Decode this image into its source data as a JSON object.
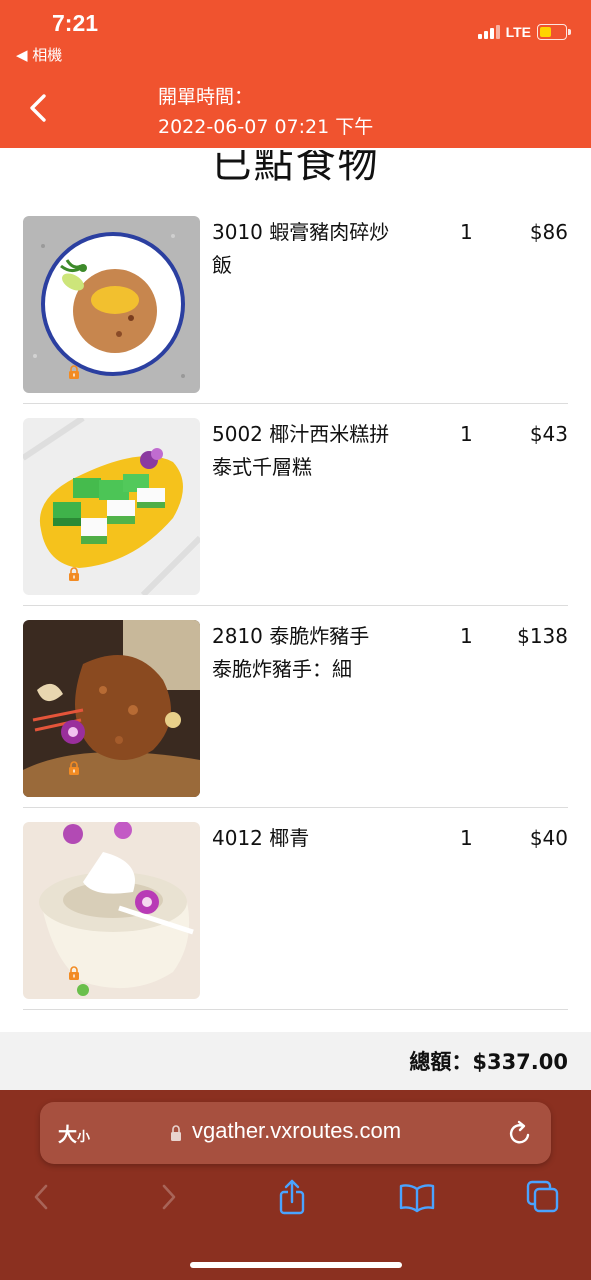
{
  "status_bar": {
    "time": "7:21",
    "back_app": "◀ 相機",
    "network": "LTE"
  },
  "header": {
    "title_label": "開單時間：",
    "title_value": "2022-06-07 07:21 下午"
  },
  "section_title": "已點食物",
  "items": [
    {
      "name_lines": [
        "3010 蝦膏豬肉碎炒",
        "飯"
      ],
      "qty": "1",
      "price": "$86"
    },
    {
      "name_lines": [
        "5002 椰汁西米糕拼",
        "泰式千層糕"
      ],
      "qty": "1",
      "price": "$43"
    },
    {
      "name_lines": [
        "2810 泰脆炸豬手",
        "泰脆炸豬手：細"
      ],
      "qty": "1",
      "price": "$138"
    },
    {
      "name_lines": [
        "4012 椰青"
      ],
      "qty": "1",
      "price": "$40"
    }
  ],
  "total": "總額：$337.00",
  "browser": {
    "text_size_big": "大",
    "text_size_small": "小",
    "url": "vgather.vxroutes.com"
  },
  "colors": {
    "header_bg": "#f0532f",
    "browser_bar": "#8b3020",
    "accent_blue": "#4aa3ff"
  },
  "icons": {
    "nav_back": "chevron-left-icon",
    "lock": "lock-icon",
    "reload": "reload-icon",
    "share": "share-icon",
    "bookmarks": "book-icon",
    "tabs": "tabs-icon"
  }
}
